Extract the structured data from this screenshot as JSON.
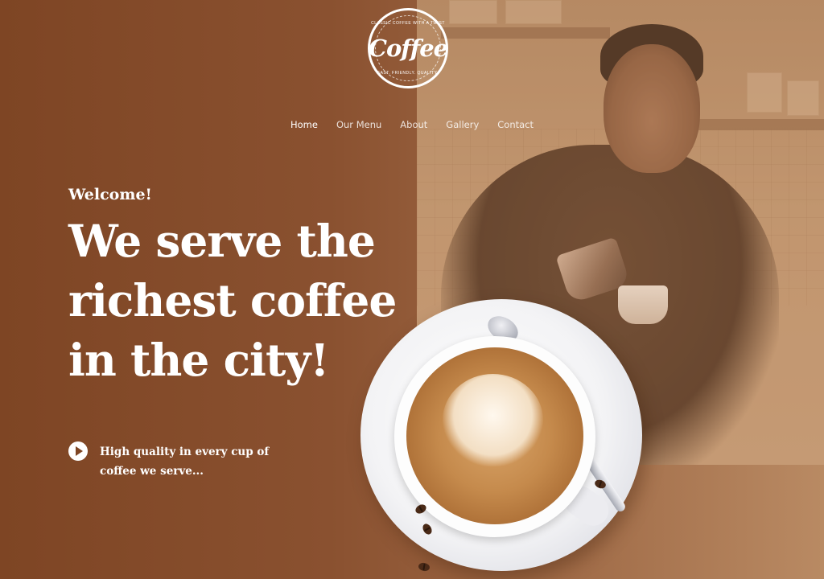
{
  "logo": {
    "word": "Coffee",
    "arc_top": "CLASSIC COFFEE WITH A TWIST",
    "arc_bottom": "FAST. FRIENDLY. QUALITY."
  },
  "nav": {
    "items": [
      {
        "label": "Home",
        "active": true
      },
      {
        "label": "Our Menu",
        "active": false
      },
      {
        "label": "About",
        "active": false
      },
      {
        "label": "Gallery",
        "active": false
      },
      {
        "label": "Contact",
        "active": false
      }
    ]
  },
  "hero": {
    "welcome": "Welcome!",
    "headline": "We serve the richest coffee in the city!",
    "tagline": "High quality in every cup of coffee we serve..."
  },
  "colors": {
    "background": "#8a5130",
    "accent": "#ffffff"
  },
  "icons": {
    "play": "play-icon"
  }
}
